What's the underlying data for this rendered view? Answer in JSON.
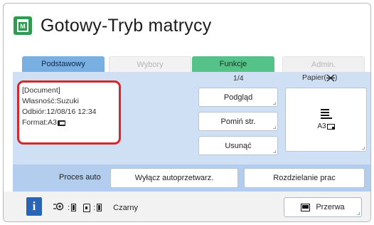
{
  "title": {
    "text": "Gotowy-Tryb matrycy",
    "icon": "master-mode-icon",
    "accent_color": "#2f9b4f"
  },
  "tabs": [
    {
      "label": "Podstawowy",
      "state": "active",
      "color": "#79afe1"
    },
    {
      "label": "Wybory",
      "state": "disabled"
    },
    {
      "label": "Funkcje",
      "state": "enabled",
      "color": "#55c289"
    },
    {
      "label": "Admin.",
      "state": "disabled"
    }
  ],
  "document": {
    "name": "[Document]",
    "owner": "Własność:Suzuki",
    "received": "Odbiór:12/08/16 12:34",
    "format": "Format:A3",
    "highlight_color": "#d4272e"
  },
  "page_indicator": "1/4",
  "buttons": {
    "preview": "Podgląd",
    "skip_page": "Pomiń str.",
    "delete": "Usunąć"
  },
  "paper": {
    "label": "Papier(",
    "label_end": ")",
    "size": "A3",
    "icon": "paper-stack-icon"
  },
  "auto_process": {
    "label": "Proces auto",
    "disable_button": "Wyłącz autoprzetwarz.",
    "split_button": "Rozdzielanie prac"
  },
  "status": {
    "color_name": "Czarny",
    "pause_button": "Przerwa"
  },
  "colors": {
    "panel": "#cfe0f4",
    "auto_row": "#b3cdee",
    "status_bar": "#f2f2f2",
    "info_button": "#2a64b4"
  }
}
